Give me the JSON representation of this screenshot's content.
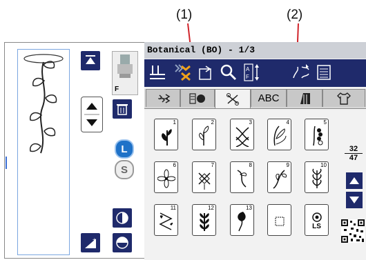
{
  "callouts": {
    "one": "(1)",
    "two": "(2)"
  },
  "header": {
    "title": "Botanical (BO) - 1/3"
  },
  "left": {
    "foot_label": "F",
    "mode_l": "L",
    "mode_s": "S"
  },
  "tabs": [
    {
      "label": "stitch-utility",
      "icon": "utility-stitch-icon"
    },
    {
      "label": "stitch-satin",
      "icon": "satin-stitch-icon"
    },
    {
      "label": "stitch-decorative",
      "icon": "decorative-stitch-icon",
      "active": true
    },
    {
      "label": "ABC"
    },
    {
      "label": "quilt",
      "icon": "quilt-icon"
    },
    {
      "label": "garment",
      "icon": "shirt-icon"
    }
  ],
  "patterns": [
    {
      "num": "1"
    },
    {
      "num": "2"
    },
    {
      "num": "3"
    },
    {
      "num": "4"
    },
    {
      "num": "5"
    },
    {
      "num": "6"
    },
    {
      "num": "7"
    },
    {
      "num": "8"
    },
    {
      "num": "9"
    },
    {
      "num": "10"
    },
    {
      "num": "11"
    },
    {
      "num": "12"
    },
    {
      "num": "13"
    },
    {
      "num": ""
    },
    {
      "num": "LS"
    }
  ],
  "page": {
    "current": "32",
    "total": "47"
  },
  "colors": {
    "navy": "#1f2a6b",
    "accent_orange": "#f0a11a",
    "arrow_red": "#d0232a"
  }
}
